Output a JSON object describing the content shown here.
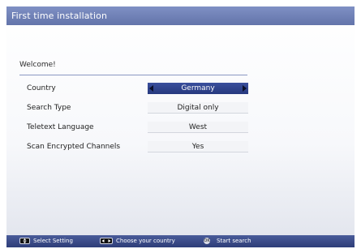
{
  "window": {
    "title": "First time installation"
  },
  "main": {
    "welcome": "Welcome!",
    "rows": [
      {
        "label": "Country",
        "value": "Germany",
        "selected": true
      },
      {
        "label": "Search Type",
        "value": "Digital only"
      },
      {
        "label": "Teletext Language",
        "value": "West"
      },
      {
        "label": "Scan Encrypted Channels",
        "value": "Yes"
      }
    ]
  },
  "footer": {
    "hints": [
      {
        "icon": "up-down-key-icon",
        "label": "Select Setting"
      },
      {
        "icon": "left-right-key-icon",
        "label": "Choose your country"
      },
      {
        "icon": "ok-key-icon",
        "label": "Start search"
      }
    ]
  },
  "colors": {
    "title_bar": "#6f80b8",
    "selected_row": "#2f4390",
    "footer": "#3a4a86"
  }
}
